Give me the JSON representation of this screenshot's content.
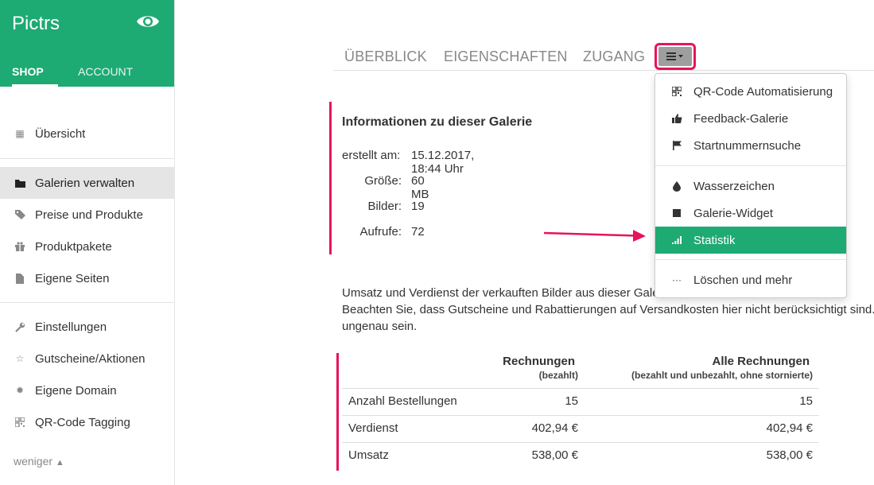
{
  "app": {
    "title": "Pictrs"
  },
  "sidebar_tabs": {
    "shop": "SHOP",
    "account": "ACCOUNT"
  },
  "nav": [
    {
      "label": "Übersicht",
      "icon": "calendar-icon"
    },
    {
      "label": "Galerien verwalten",
      "icon": "folder-icon"
    },
    {
      "label": "Preise und Produkte",
      "icon": "tags-icon"
    },
    {
      "label": "Produktpakete",
      "icon": "gift-icon"
    },
    {
      "label": "Eigene Seiten",
      "icon": "file-icon"
    },
    {
      "label": "Einstellungen",
      "icon": "wrench-icon"
    },
    {
      "label": "Gutscheine/Aktionen",
      "icon": "star-icon"
    },
    {
      "label": "Eigene Domain",
      "icon": "certificate-icon"
    },
    {
      "label": "QR-Code Tagging",
      "icon": "qrcode-icon"
    }
  ],
  "nav_less": "weniger",
  "tabs": {
    "overview": "ÜBERBLICK",
    "properties": "EIGENSCHAFTEN",
    "access": "ZUGANG"
  },
  "info": {
    "title": "Informationen zu dieser Galerie",
    "rows": [
      {
        "label": "erstellt am:",
        "value": "15.12.2017, 18:44 Uhr"
      },
      {
        "label": "Größe:",
        "value": "60 MB"
      },
      {
        "label": "Bilder:",
        "value": "19"
      },
      {
        "label": "Aufrufe:",
        "value": "72"
      }
    ]
  },
  "dropdown": [
    {
      "label": "QR-Code Automatisierung",
      "icon": "qrcode-icon"
    },
    {
      "label": "Feedback-Galerie",
      "icon": "thumbs-up-icon"
    },
    {
      "label": "Startnummernsuche",
      "icon": "flag-icon"
    },
    {
      "label": "Wasserzeichen",
      "icon": "tint-icon"
    },
    {
      "label": "Galerie-Widget",
      "icon": "stop-icon"
    },
    {
      "label": "Statistik",
      "icon": "signal-icon"
    },
    {
      "label": "Löschen und mehr",
      "icon": "ellipsis-icon"
    }
  ],
  "description": {
    "line1": "Umsatz und Verdienst der verkauften Bilder aus dieser Gale",
    "line2": "Beachten Sie, dass Gutscheine und Rabattierungen auf Versandkosten hier nicht berücksichtigt sind.",
    "line3": "ungenau sein."
  },
  "table": {
    "col1": {
      "title": "Rechnungen",
      "sub": "(bezahlt)"
    },
    "col2": {
      "title": "Alle Rechnungen",
      "sub": "(bezahlt und unbezahlt, ohne stornierte)"
    },
    "rows": [
      {
        "label": "Anzahl Bestellungen",
        "paid": "15",
        "all": "15"
      },
      {
        "label": "Verdienst",
        "paid": "402,94 €",
        "all": "402,94 €"
      },
      {
        "label": "Umsatz",
        "paid": "538,00 €",
        "all": "538,00 €"
      }
    ]
  },
  "colors": {
    "brand": "#1eaa73",
    "highlight": "#e8125e"
  }
}
